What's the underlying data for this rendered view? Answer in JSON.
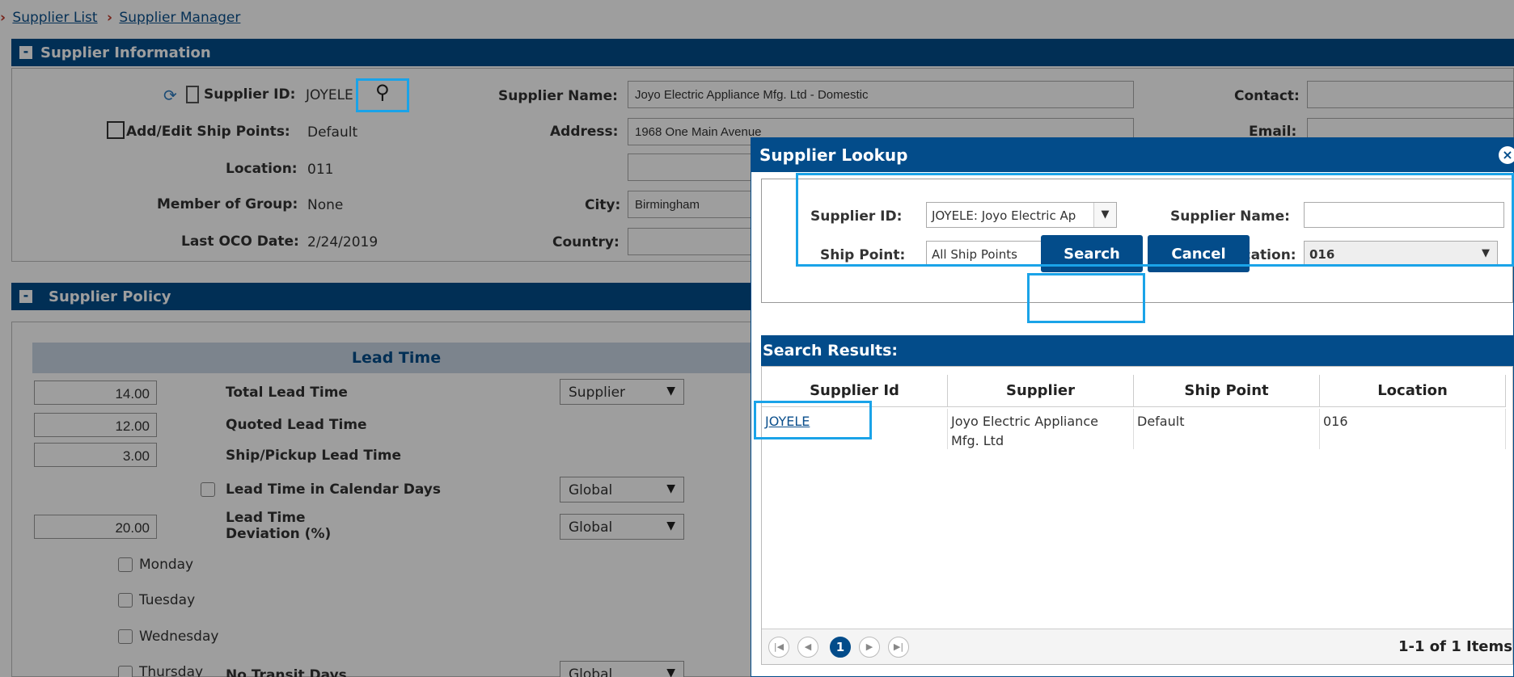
{
  "breadcrumb": {
    "arrow": "›",
    "items": [
      "Supplier List",
      "Supplier Manager"
    ]
  },
  "supplier_info": {
    "title": "Supplier Information",
    "toggle": "-",
    "supplier_id_label": "Supplier ID:",
    "supplier_id_value": "JOYELE",
    "ship_points_label": "Add/Edit Ship Points:",
    "ship_points_value": "Default",
    "location_label": "Location:",
    "location_value": "011",
    "group_label": "Member of Group:",
    "group_value": "None",
    "last_oco_label": "Last OCO Date:",
    "last_oco_value": "2/24/2019",
    "supplier_name_label": "Supplier Name:",
    "supplier_name_value": "Joyo Electric Appliance Mfg. Ltd - Domestic",
    "address_label": "Address:",
    "address_value": "1968 One Main Avenue",
    "city_label": "City:",
    "city_value": "Birmingham",
    "country_label": "Country:",
    "contact_label": "Contact:",
    "email_label": "Email:"
  },
  "supplier_policy": {
    "title": "Supplier Policy",
    "toggle": "-",
    "lead_time_header": "Lead Time",
    "total_lead_time": {
      "value": "14.00",
      "label": "Total Lead Time",
      "source": "Supplier"
    },
    "quoted_lead_time": {
      "value": "12.00",
      "label": "Quoted Lead Time"
    },
    "ship_pickup_lead_time": {
      "value": "3.00",
      "label": "Ship/Pickup Lead Time"
    },
    "calendar_days": {
      "label": "Lead Time in Calendar Days",
      "source": "Global"
    },
    "deviation": {
      "value": "20.00",
      "label_line1": "Lead Time",
      "label_line2": "Deviation (%)",
      "source": "Global"
    },
    "days": [
      "Monday",
      "Tuesday",
      "Wednesday",
      "Thursday"
    ],
    "no_transit_label": "No Transit Days",
    "no_transit_source": "Global"
  },
  "lookup": {
    "title": "Supplier Lookup",
    "close": "×",
    "supplier_id_label": "Supplier ID:",
    "supplier_id_value": "JOYELE: Joyo Electric Ap",
    "supplier_name_label": "Supplier Name:",
    "supplier_name_value": "",
    "ship_point_label": "Ship Point:",
    "ship_point_value": "All Ship Points",
    "location_label": "Location:",
    "location_value": "016",
    "search_label": "Search",
    "cancel_label": "Cancel",
    "results_title": "Search Results:",
    "columns": [
      "Supplier Id",
      "Supplier",
      "Ship Point",
      "Location"
    ],
    "rows": [
      {
        "supplier_id": "JOYELE",
        "supplier_line1": "Joyo Electric Appliance",
        "supplier_line2": "Mfg. Ltd",
        "ship_point": "Default",
        "location": "016"
      }
    ],
    "pager": {
      "first": "|◀",
      "prev": "◀",
      "page": "1",
      "next": "▶",
      "last": "▶|",
      "info": "1-1 of 1 Items"
    }
  },
  "colors": {
    "brand": "#034c8a",
    "highlight": "#1aa3e8"
  }
}
